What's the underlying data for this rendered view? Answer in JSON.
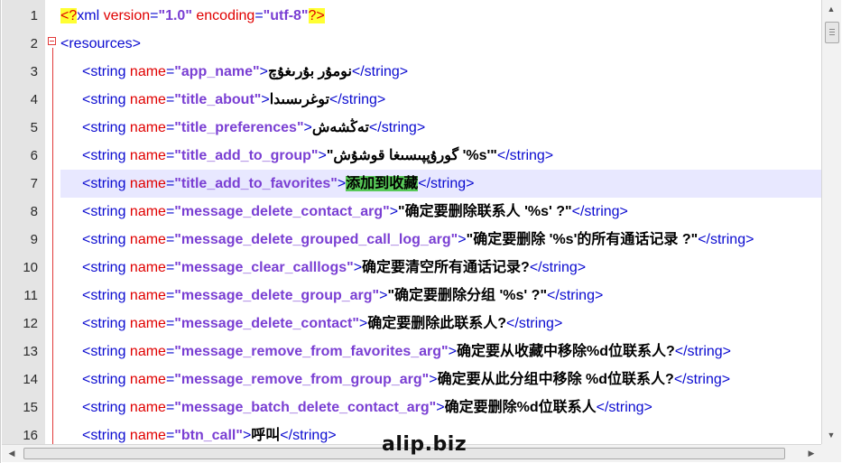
{
  "lines": [
    {
      "num": "1",
      "kind": "decl",
      "segs": [
        {
          "t": "<?",
          "c": "pi"
        },
        {
          "t": "xml ",
          "c": "tag"
        },
        {
          "t": "version",
          "c": "an"
        },
        {
          "t": "=",
          "c": "tag"
        },
        {
          "t": "\"1.0\"",
          "c": "av"
        },
        {
          "t": " ",
          "c": "tag"
        },
        {
          "t": "encoding",
          "c": "an"
        },
        {
          "t": "=",
          "c": "tag"
        },
        {
          "t": "\"utf-8\"",
          "c": "av"
        },
        {
          "t": "?>",
          "c": "pi"
        }
      ]
    },
    {
      "num": "2",
      "kind": "open",
      "segs": [
        {
          "t": "<resources>",
          "c": "tag"
        }
      ]
    },
    {
      "num": "3",
      "segs": [
        {
          "t": "<string ",
          "c": "tag"
        },
        {
          "t": "name",
          "c": "an"
        },
        {
          "t": "=",
          "c": "tag"
        },
        {
          "t": "\"app_name\"",
          "c": "av"
        },
        {
          "t": ">",
          "c": "tag"
        },
        {
          "t": "نومۇر بۇرىغۇچ",
          "c": "txt"
        },
        {
          "t": "</string>",
          "c": "tag"
        }
      ]
    },
    {
      "num": "4",
      "segs": [
        {
          "t": "<string ",
          "c": "tag"
        },
        {
          "t": "name",
          "c": "an"
        },
        {
          "t": "=",
          "c": "tag"
        },
        {
          "t": "\"title_about\"",
          "c": "av"
        },
        {
          "t": ">",
          "c": "tag"
        },
        {
          "t": "توغرىسىدا",
          "c": "txt"
        },
        {
          "t": "</string>",
          "c": "tag"
        }
      ]
    },
    {
      "num": "5",
      "segs": [
        {
          "t": "<string ",
          "c": "tag"
        },
        {
          "t": "name",
          "c": "an"
        },
        {
          "t": "=",
          "c": "tag"
        },
        {
          "t": "\"title_preferences\"",
          "c": "av"
        },
        {
          "t": ">",
          "c": "tag"
        },
        {
          "t": "تەڭشەش",
          "c": "txt"
        },
        {
          "t": "</string>",
          "c": "tag"
        }
      ]
    },
    {
      "num": "6",
      "segs": [
        {
          "t": "<string ",
          "c": "tag"
        },
        {
          "t": "name",
          "c": "an"
        },
        {
          "t": "=",
          "c": "tag"
        },
        {
          "t": "\"title_add_to_group\"",
          "c": "av"
        },
        {
          "t": ">",
          "c": "tag"
        },
        {
          "t": "\"گورۇپپىسىغا قوشۇش  '%s'\"",
          "c": "txt"
        },
        {
          "t": "</string>",
          "c": "tag"
        }
      ]
    },
    {
      "num": "7",
      "cur": true,
      "segs": [
        {
          "t": "<string ",
          "c": "tag"
        },
        {
          "t": "name",
          "c": "an"
        },
        {
          "t": "=",
          "c": "tag"
        },
        {
          "t": "\"title_add_to_favorites\"",
          "c": "av"
        },
        {
          "t": ">",
          "c": "tag"
        },
        {
          "t": "添加到收藏",
          "c": "txt hl"
        },
        {
          "t": "</string>",
          "c": "tag"
        }
      ]
    },
    {
      "num": "8",
      "segs": [
        {
          "t": "<string ",
          "c": "tag"
        },
        {
          "t": "name",
          "c": "an"
        },
        {
          "t": "=",
          "c": "tag"
        },
        {
          "t": "\"message_delete_contact_arg\"",
          "c": "av"
        },
        {
          "t": ">",
          "c": "tag"
        },
        {
          "t": "\"确定要删除联系人 '%s' ?\"",
          "c": "txt"
        },
        {
          "t": "</string>",
          "c": "tag"
        }
      ]
    },
    {
      "num": "9",
      "segs": [
        {
          "t": "<string ",
          "c": "tag"
        },
        {
          "t": "name",
          "c": "an"
        },
        {
          "t": "=",
          "c": "tag"
        },
        {
          "t": "\"message_delete_grouped_call_log_arg\"",
          "c": "av"
        },
        {
          "t": ">",
          "c": "tag"
        },
        {
          "t": "\"确定要删除 '%s'的所有通话记录 ?\"",
          "c": "txt"
        },
        {
          "t": "</string>",
          "c": "tag"
        }
      ]
    },
    {
      "num": "10",
      "segs": [
        {
          "t": "<string ",
          "c": "tag"
        },
        {
          "t": "name",
          "c": "an"
        },
        {
          "t": "=",
          "c": "tag"
        },
        {
          "t": "\"message_clear_calllogs\"",
          "c": "av"
        },
        {
          "t": ">",
          "c": "tag"
        },
        {
          "t": "确定要清空所有通话记录?",
          "c": "txt"
        },
        {
          "t": "</string>",
          "c": "tag"
        }
      ]
    },
    {
      "num": "11",
      "segs": [
        {
          "t": "<string ",
          "c": "tag"
        },
        {
          "t": "name",
          "c": "an"
        },
        {
          "t": "=",
          "c": "tag"
        },
        {
          "t": "\"message_delete_group_arg\"",
          "c": "av"
        },
        {
          "t": ">",
          "c": "tag"
        },
        {
          "t": "\"确定要删除分组 '%s' ?\"",
          "c": "txt"
        },
        {
          "t": "</string>",
          "c": "tag"
        }
      ]
    },
    {
      "num": "12",
      "segs": [
        {
          "t": "<string ",
          "c": "tag"
        },
        {
          "t": "name",
          "c": "an"
        },
        {
          "t": "=",
          "c": "tag"
        },
        {
          "t": "\"message_delete_contact\"",
          "c": "av"
        },
        {
          "t": ">",
          "c": "tag"
        },
        {
          "t": "确定要删除此联系人?",
          "c": "txt"
        },
        {
          "t": "</string>",
          "c": "tag"
        }
      ]
    },
    {
      "num": "13",
      "segs": [
        {
          "t": "<string ",
          "c": "tag"
        },
        {
          "t": "name",
          "c": "an"
        },
        {
          "t": "=",
          "c": "tag"
        },
        {
          "t": "\"message_remove_from_favorites_arg\"",
          "c": "av"
        },
        {
          "t": ">",
          "c": "tag"
        },
        {
          "t": "确定要从收藏中移除%d位联系人?",
          "c": "txt"
        },
        {
          "t": "</string>",
          "c": "tag"
        }
      ]
    },
    {
      "num": "14",
      "segs": [
        {
          "t": "<string ",
          "c": "tag"
        },
        {
          "t": "name",
          "c": "an"
        },
        {
          "t": "=",
          "c": "tag"
        },
        {
          "t": "\"message_remove_from_group_arg\"",
          "c": "av"
        },
        {
          "t": ">",
          "c": "tag"
        },
        {
          "t": "确定要从此分组中移除 %d位联系人?",
          "c": "txt"
        },
        {
          "t": "</string>",
          "c": "tag"
        }
      ]
    },
    {
      "num": "15",
      "segs": [
        {
          "t": "<string ",
          "c": "tag"
        },
        {
          "t": "name",
          "c": "an"
        },
        {
          "t": "=",
          "c": "tag"
        },
        {
          "t": "\"message_batch_delete_contact_arg\"",
          "c": "av"
        },
        {
          "t": ">",
          "c": "tag"
        },
        {
          "t": "确定要删除%d位联系人",
          "c": "txt"
        },
        {
          "t": "</string>",
          "c": "tag"
        }
      ]
    },
    {
      "num": "16",
      "segs": [
        {
          "t": "<string ",
          "c": "tag"
        },
        {
          "t": "name",
          "c": "an"
        },
        {
          "t": "=",
          "c": "tag"
        },
        {
          "t": "\"btn_call\"",
          "c": "av"
        },
        {
          "t": ">",
          "c": "tag"
        },
        {
          "t": "呼叫",
          "c": "txt"
        },
        {
          "t": "</string>",
          "c": "tag"
        }
      ]
    }
  ],
  "watermark": "alip.biz",
  "icons": {
    "scroll_up": "▲",
    "scroll_down": "▼",
    "scroll_left": "◀",
    "scroll_right": "▶"
  },
  "colors": {
    "tag": "#0a0ad0",
    "attr_name": "#e00000",
    "attr_value": "#7a3fd3",
    "pi_highlight": "#ffff33",
    "selection": "#58c858",
    "current_line": "#e8e8ff",
    "fold_marker": "#e23a3a"
  }
}
